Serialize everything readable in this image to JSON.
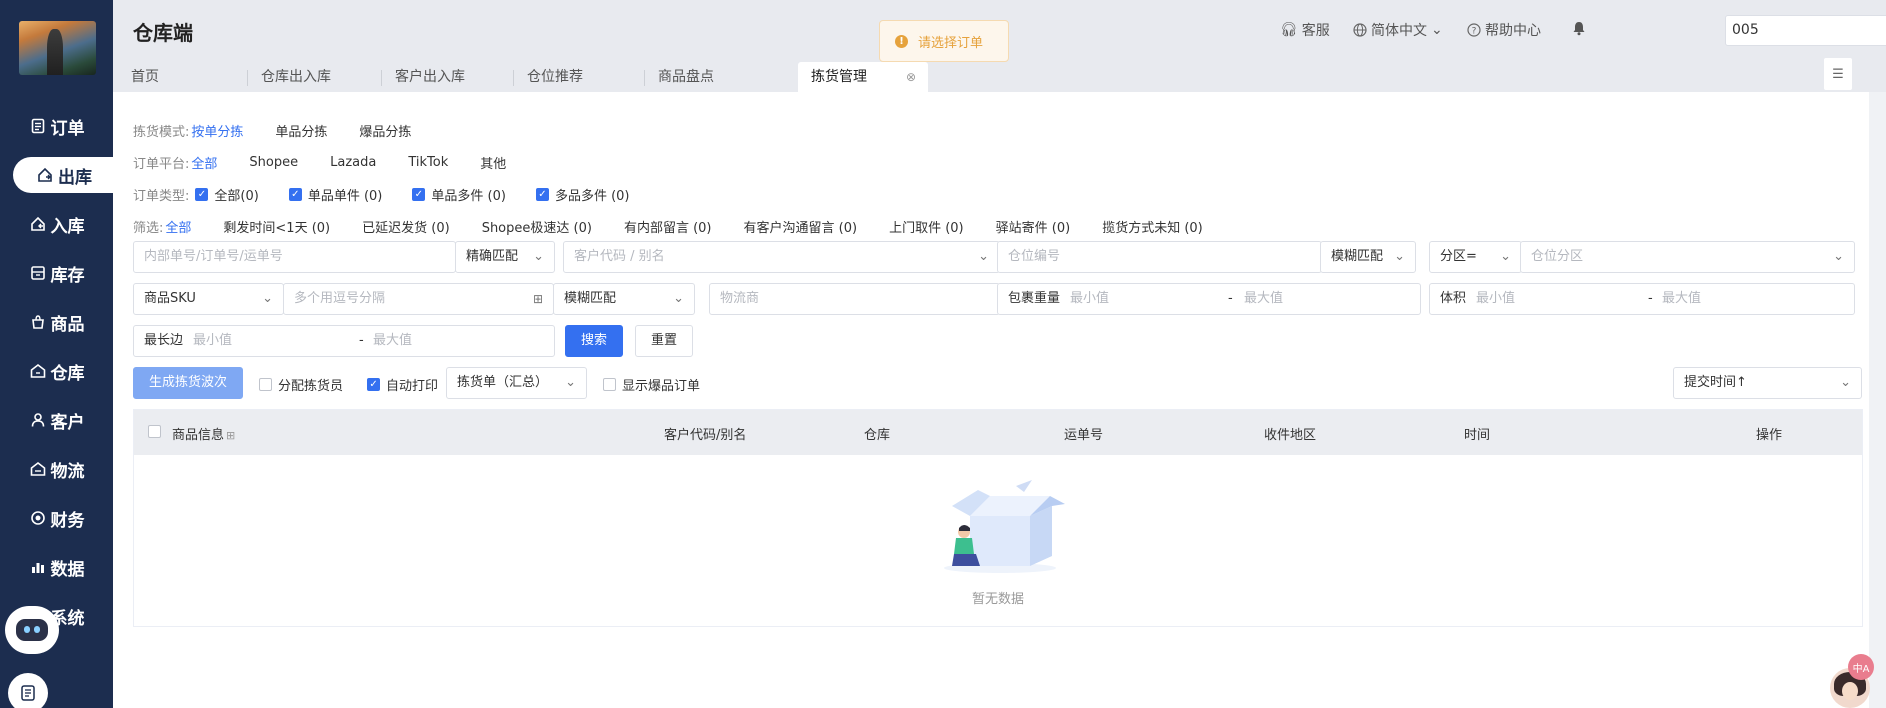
{
  "header": {
    "app_title": "仓库端",
    "toast": "请选择订单",
    "service": "客服",
    "language": "简体中文",
    "help": "帮助中心",
    "store_value": "005"
  },
  "sidebar": {
    "items": [
      {
        "label": "订单",
        "icon": "order-icon"
      },
      {
        "label": "出库",
        "icon": "outbound-icon"
      },
      {
        "label": "入库",
        "icon": "inbound-icon"
      },
      {
        "label": "库存",
        "icon": "inventory-icon"
      },
      {
        "label": "商品",
        "icon": "goods-icon"
      },
      {
        "label": "仓库",
        "icon": "warehouse-icon"
      },
      {
        "label": "客户",
        "icon": "customer-icon"
      },
      {
        "label": "物流",
        "icon": "logistics-icon"
      },
      {
        "label": "财务",
        "icon": "finance-icon"
      },
      {
        "label": "数据",
        "icon": "data-icon"
      },
      {
        "label": "系统",
        "icon": "system-icon"
      }
    ],
    "active_index": 1
  },
  "tabs": [
    "首页",
    "仓库出入库",
    "客户出入库",
    "仓位推荐",
    "商品盘点",
    "拣货管理"
  ],
  "filters": {
    "pick_mode": {
      "label": "拣货模式:",
      "options": [
        "按单分拣",
        "单品分拣",
        "爆品分拣"
      ]
    },
    "platform": {
      "label": "订单平台:",
      "options": [
        "全部",
        "Shopee",
        "Lazada",
        "TikTok",
        "其他"
      ]
    },
    "order_type": {
      "label": "订单类型:",
      "options": [
        "全部(0)",
        "单品单件 (0)",
        "单品多件 (0)",
        "多品多件 (0)"
      ]
    },
    "screen": {
      "label": "筛选:",
      "options": [
        "全部",
        "剩发时间<1天 (0)",
        "已延迟发货 (0)",
        "Shopee极速达 (0)",
        "有内部留言 (0)",
        "有客户沟通留言 (0)",
        "上门取件 (0)",
        "驿站寄件 (0)",
        "揽货方式未知 (0)"
      ]
    }
  },
  "search": {
    "order_no_placeholder": "内部单号/订单号/运单号",
    "exact_match": "精确匹配",
    "customer_placeholder": "客户代码 / 别名",
    "location_placeholder": "仓位编号",
    "fuzzy_match": "模糊匹配",
    "zone_op": "分区=",
    "zone_placeholder": "仓位分区",
    "sku_type": "商品SKU",
    "sku_placeholder": "多个用逗号分隔",
    "sku_match": "模糊匹配",
    "carrier_placeholder": "物流商",
    "weight_label": "包裹重量",
    "volume_label": "体积",
    "longest_label": "最长边",
    "min_placeholder": "最小值",
    "max_placeholder": "最大值",
    "dash": "-",
    "search_btn": "搜索",
    "reset_btn": "重置"
  },
  "actions": {
    "generate_btn": "生成拣货波次",
    "assign_picker": "分配拣货员",
    "auto_print": "自动打印",
    "print_type": "拣货单（汇总）",
    "show_hot": "显示爆品订单",
    "sort": "提交时间↑"
  },
  "table": {
    "columns": [
      "商品信息",
      "客户代码/别名",
      "仓库",
      "运单号",
      "收件地区",
      "时间",
      "操作"
    ],
    "empty_text": "暂无数据"
  },
  "colors": {
    "sidebar": "#1c2d4f",
    "accent": "#3470f0",
    "toast": "#e6a23c"
  }
}
